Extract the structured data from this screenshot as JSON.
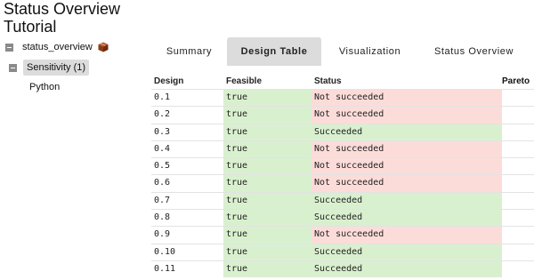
{
  "page": {
    "title_line1": "Status Overview",
    "title_line2": "Tutorial"
  },
  "tree": {
    "root_label": "status_overview",
    "root_icon": "package-icon",
    "child_label": "Sensitivity (1)",
    "leaf_label": "Python"
  },
  "tabs": [
    {
      "label": "Summary",
      "active": false
    },
    {
      "label": "Design Table",
      "active": true
    },
    {
      "label": "Visualization",
      "active": false
    },
    {
      "label": "Status Overview",
      "active": false
    }
  ],
  "table": {
    "headers": {
      "design": "Design",
      "feasible": "Feasible",
      "status": "Status",
      "pareto": "Pareto"
    },
    "rows": [
      {
        "design": "0.1",
        "feasible": "true",
        "status": "Not succeeded"
      },
      {
        "design": "0.2",
        "feasible": "true",
        "status": "Not succeeded"
      },
      {
        "design": "0.3",
        "feasible": "true",
        "status": "Succeeded"
      },
      {
        "design": "0.4",
        "feasible": "true",
        "status": "Not succeeded"
      },
      {
        "design": "0.5",
        "feasible": "true",
        "status": "Not succeeded"
      },
      {
        "design": "0.6",
        "feasible": "true",
        "status": "Not succeeded"
      },
      {
        "design": "0.7",
        "feasible": "true",
        "status": "Succeeded"
      },
      {
        "design": "0.8",
        "feasible": "true",
        "status": "Succeeded"
      },
      {
        "design": "0.9",
        "feasible": "true",
        "status": "Not succeeded"
      },
      {
        "design": "0.10",
        "feasible": "true",
        "status": "Succeeded"
      },
      {
        "design": "0.11",
        "feasible": "true",
        "status": "Succeeded"
      }
    ]
  },
  "colors": {
    "success": "#d9f0cf",
    "failure": "#fcdcd9",
    "tab_active": "#dcdcdc"
  }
}
